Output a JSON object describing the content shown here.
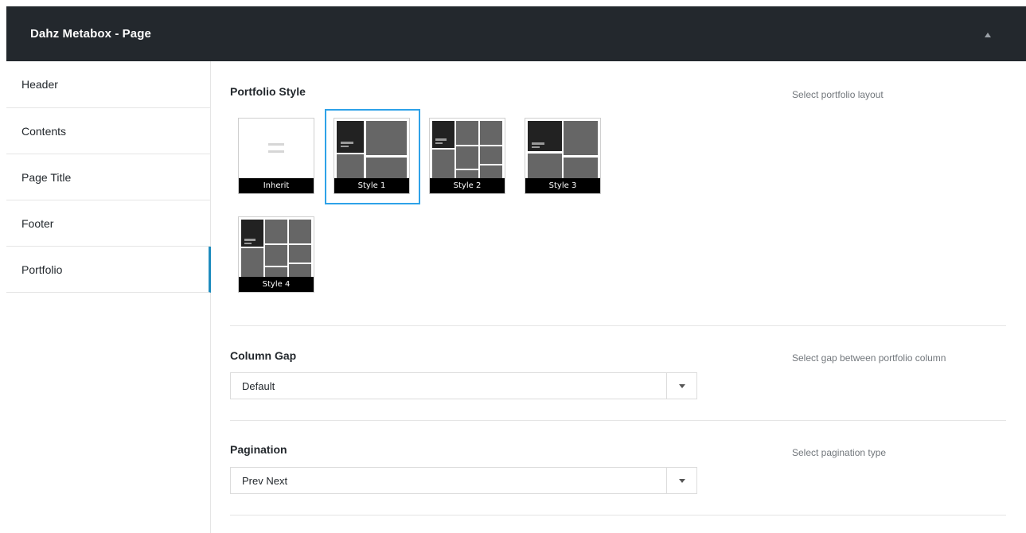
{
  "metabox": {
    "title": "Dahz Metabox - Page",
    "toggle_icon": "triangle-up-icon"
  },
  "sidebar": {
    "items": [
      {
        "label": "Header",
        "active": false
      },
      {
        "label": "Contents",
        "active": false
      },
      {
        "label": "Page Title",
        "active": false
      },
      {
        "label": "Footer",
        "active": false
      },
      {
        "label": "Portfolio",
        "active": true
      }
    ]
  },
  "portfolio_style": {
    "title": "Portfolio Style",
    "description": "Select portfolio layout",
    "options": [
      {
        "label": "Inherit",
        "selected": false
      },
      {
        "label": "Style 1",
        "selected": true
      },
      {
        "label": "Style 2",
        "selected": false
      },
      {
        "label": "Style 3",
        "selected": false
      },
      {
        "label": "Style 4",
        "selected": false
      }
    ]
  },
  "column_gap": {
    "title": "Column Gap",
    "description": "Select gap between portfolio column",
    "value": "Default"
  },
  "pagination": {
    "title": "Pagination",
    "description": "Select pagination type",
    "value": "Prev Next"
  },
  "colors": {
    "header_bg": "#23282d",
    "accent": "#2ea2e8",
    "thumb_dark": "#222222",
    "thumb_tile": "#666666"
  }
}
